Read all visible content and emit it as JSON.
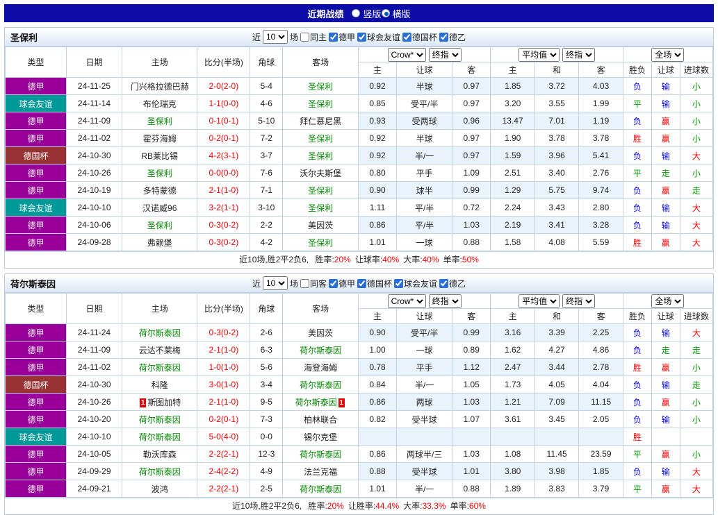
{
  "topbar": {
    "title": "近期战绩",
    "options": [
      {
        "label": "竖版",
        "selected": false
      },
      {
        "label": "横版",
        "selected": true
      }
    ]
  },
  "colors": {
    "type_bg": {
      "德甲": "#990099",
      "球会友谊": "#009999",
      "德国杯": "#993333"
    },
    "result_text": {
      "胜": "#ff0000",
      "平": "#009900",
      "负": "#0000ff",
      "赢": "#ff0000",
      "走": "#009900",
      "输": "#0000ff",
      "大": "#ff0000",
      "小": "#009900"
    },
    "focus_team": "#008800",
    "score": "#ff0000"
  },
  "table_header": {
    "static_cols": [
      "类型",
      "日期",
      "主场",
      "比分(半场)",
      "角球",
      "客场"
    ],
    "groups": [
      [
        "Crow*",
        "终指"
      ],
      [
        "平均值",
        "终指"
      ],
      [
        "全场"
      ]
    ],
    "sub_cols": [
      "主",
      "让球",
      "客",
      "主",
      "和",
      "客",
      "胜负",
      "让球",
      "进球数"
    ]
  },
  "sections": [
    {
      "team": "圣保利",
      "filter": {
        "recent_label": "近",
        "recent_value": "10",
        "games_label": "场",
        "same_label": "同主",
        "same_checked": false,
        "leagues": [
          {
            "label": "德甲",
            "checked": true
          },
          {
            "label": "球会友谊",
            "checked": true
          },
          {
            "label": "德国杯",
            "checked": true
          },
          {
            "label": "德乙",
            "checked": true
          }
        ]
      },
      "rows": [
        {
          "type": "德甲",
          "date": "24-11-25",
          "home": "门兴格拉德巴赫",
          "home_focus": false,
          "home_card": "",
          "score": "2-0(2-0)",
          "corner": "5-4",
          "away": "圣保利",
          "away_focus": true,
          "away_card": "",
          "odds": [
            "0.92",
            "半球",
            "0.97",
            "1.85",
            "3.72",
            "4.03"
          ],
          "results": [
            "负",
            "输",
            "小"
          ]
        },
        {
          "type": "球会友谊",
          "date": "24-11-14",
          "home": "布伦瑞克",
          "home_focus": false,
          "home_card": "",
          "score": "1-1(0-0)",
          "corner": "4-6",
          "away": "圣保利",
          "away_focus": true,
          "away_card": "",
          "odds": [
            "0.85",
            "受平/半",
            "0.97",
            "3.20",
            "3.55",
            "1.99"
          ],
          "results": [
            "平",
            "输",
            "小"
          ]
        },
        {
          "type": "德甲",
          "date": "24-11-09",
          "home": "圣保利",
          "home_focus": true,
          "home_card": "",
          "score": "0-1(0-1)",
          "corner": "5-10",
          "away": "拜仁慕尼黑",
          "away_focus": false,
          "away_card": "",
          "odds": [
            "0.93",
            "受两球",
            "0.96",
            "13.47",
            "7.01",
            "1.19"
          ],
          "results": [
            "负",
            "赢",
            "小"
          ]
        },
        {
          "type": "德甲",
          "date": "24-11-02",
          "home": "霍芬海姆",
          "home_focus": false,
          "home_card": "",
          "score": "0-2(0-1)",
          "corner": "7-2",
          "away": "圣保利",
          "away_focus": true,
          "away_card": "",
          "odds": [
            "0.92",
            "半球",
            "0.97",
            "1.90",
            "3.78",
            "3.78"
          ],
          "results": [
            "胜",
            "赢",
            "小"
          ]
        },
        {
          "type": "德国杯",
          "date": "24-10-30",
          "home": "RB莱比锡",
          "home_focus": false,
          "home_card": "",
          "score": "4-2(3-1)",
          "corner": "3-7",
          "away": "圣保利",
          "away_focus": true,
          "away_card": "",
          "odds": [
            "0.92",
            "半/一",
            "0.97",
            "1.59",
            "3.96",
            "5.41"
          ],
          "results": [
            "负",
            "输",
            "大"
          ]
        },
        {
          "type": "德甲",
          "date": "24-10-26",
          "home": "圣保利",
          "home_focus": true,
          "home_card": "",
          "score": "0-0(0-0)",
          "corner": "7-6",
          "away": "沃尔夫斯堡",
          "away_focus": false,
          "away_card": "",
          "odds": [
            "0.80",
            "平手",
            "1.09",
            "2.51",
            "3.40",
            "2.76"
          ],
          "results": [
            "平",
            "走",
            "小"
          ]
        },
        {
          "type": "德甲",
          "date": "24-10-19",
          "home": "多特蒙德",
          "home_focus": false,
          "home_card": "",
          "score": "2-1(1-0)",
          "corner": "7-1",
          "away": "圣保利",
          "away_focus": true,
          "away_card": "",
          "odds": [
            "0.90",
            "球半",
            "0.99",
            "1.29",
            "5.75",
            "9.74"
          ],
          "results": [
            "负",
            "赢",
            "走"
          ]
        },
        {
          "type": "球会友谊",
          "date": "24-10-10",
          "home": "汉诺威96",
          "home_focus": false,
          "home_card": "",
          "score": "3-2(1-1)",
          "corner": "3-10",
          "away": "圣保利",
          "away_focus": true,
          "away_card": "",
          "odds": [
            "1.11",
            "平/半",
            "0.72",
            "2.24",
            "3.43",
            "2.80"
          ],
          "results": [
            "负",
            "输",
            "大"
          ]
        },
        {
          "type": "德甲",
          "date": "24-10-06",
          "home": "圣保利",
          "home_focus": true,
          "home_card": "",
          "score": "0-3(0-2)",
          "corner": "2-2",
          "away": "美因茨",
          "away_focus": false,
          "away_card": "",
          "odds": [
            "0.86",
            "平/半",
            "1.03",
            "2.19",
            "3.41",
            "3.28"
          ],
          "results": [
            "负",
            "输",
            "大"
          ]
        },
        {
          "type": "德甲",
          "date": "24-09-28",
          "home": "弗赖堡",
          "home_focus": false,
          "home_card": "",
          "score": "0-3(0-2)",
          "corner": "4-2",
          "away": "圣保利",
          "away_focus": true,
          "away_card": "",
          "odds": [
            "1.01",
            "一球",
            "0.88",
            "1.58",
            "4.08",
            "5.59"
          ],
          "results": [
            "胜",
            "赢",
            "大"
          ]
        }
      ],
      "summary": {
        "prefix": "近10场,胜2平2负6, ",
        "stats": [
          {
            "label": "胜率:",
            "value": "20%"
          },
          {
            "label": "让球率:",
            "value": "40%"
          },
          {
            "label": "大率:",
            "value": "40%"
          },
          {
            "label": "单率:",
            "value": "50%"
          }
        ]
      }
    },
    {
      "team": "荷尔斯泰因",
      "filter": {
        "recent_label": "近",
        "recent_value": "10",
        "games_label": "场",
        "same_label": "同客",
        "same_checked": false,
        "leagues": [
          {
            "label": "德甲",
            "checked": true
          },
          {
            "label": "德国杯",
            "checked": true
          },
          {
            "label": "球会友谊",
            "checked": true
          },
          {
            "label": "德乙",
            "checked": true
          }
        ]
      },
      "rows": [
        {
          "type": "德甲",
          "date": "24-11-24",
          "home": "荷尔斯泰因",
          "home_focus": true,
          "home_card": "",
          "score": "0-3(0-2)",
          "corner": "2-6",
          "away": "美因茨",
          "away_focus": false,
          "away_card": "",
          "odds": [
            "0.90",
            "受平/半",
            "0.99",
            "3.16",
            "3.39",
            "2.25"
          ],
          "results": [
            "负",
            "输",
            "大"
          ]
        },
        {
          "type": "德甲",
          "date": "24-11-09",
          "home": "云达不莱梅",
          "home_focus": false,
          "home_card": "",
          "score": "2-1(1-0)",
          "corner": "6-3",
          "away": "荷尔斯泰因",
          "away_focus": true,
          "away_card": "",
          "odds": [
            "1.00",
            "一球",
            "0.89",
            "1.62",
            "4.27",
            "4.86"
          ],
          "results": [
            "负",
            "走",
            "走"
          ]
        },
        {
          "type": "德甲",
          "date": "24-11-02",
          "home": "荷尔斯泰因",
          "home_focus": true,
          "home_card": "",
          "score": "1-0(1-0)",
          "corner": "5-6",
          "away": "海登海姆",
          "away_focus": false,
          "away_card": "",
          "odds": [
            "0.78",
            "平手",
            "1.12",
            "2.47",
            "3.44",
            "2.78"
          ],
          "results": [
            "胜",
            "赢",
            "小"
          ]
        },
        {
          "type": "德国杯",
          "date": "24-10-30",
          "home": "科隆",
          "home_focus": false,
          "home_card": "",
          "score": "3-0(1-0)",
          "corner": "3-4",
          "away": "荷尔斯泰因",
          "away_focus": true,
          "away_card": "",
          "odds": [
            "0.84",
            "半/一",
            "1.05",
            "1.73",
            "4.05",
            "4.04"
          ],
          "results": [
            "负",
            "输",
            "走"
          ]
        },
        {
          "type": "德甲",
          "date": "24-10-26",
          "home": "斯图加特",
          "home_focus": false,
          "home_card": "1",
          "score": "2-1(1-0)",
          "corner": "9-5",
          "away": "荷尔斯泰因",
          "away_focus": true,
          "away_card": "1",
          "odds": [
            "0.86",
            "两球",
            "1.03",
            "1.21",
            "7.09",
            "11.15"
          ],
          "results": [
            "负",
            "赢",
            "小"
          ]
        },
        {
          "type": "德甲",
          "date": "24-10-20",
          "home": "荷尔斯泰因",
          "home_focus": true,
          "home_card": "",
          "score": "0-2(0-1)",
          "corner": "7-3",
          "away": "柏林联合",
          "away_focus": false,
          "away_card": "",
          "odds": [
            "0.82",
            "受半球",
            "1.07",
            "3.61",
            "3.45",
            "2.05"
          ],
          "results": [
            "负",
            "输",
            "小"
          ]
        },
        {
          "type": "球会友谊",
          "date": "24-10-10",
          "home": "荷尔斯泰因",
          "home_focus": true,
          "home_card": "",
          "score": "5-0(4-0)",
          "corner": "0-0",
          "away": "锡尔克堡",
          "away_focus": false,
          "away_card": "",
          "odds": [
            "",
            "",
            "",
            "",
            "",
            ""
          ],
          "results": [
            "胜",
            "",
            ""
          ]
        },
        {
          "type": "德甲",
          "date": "24-10-05",
          "home": "勒沃库森",
          "home_focus": false,
          "home_card": "",
          "score": "2-2(2-1)",
          "corner": "12-3",
          "away": "荷尔斯泰因",
          "away_focus": true,
          "away_card": "",
          "odds": [
            "0.86",
            "两球半/三",
            "1.03",
            "1.08",
            "11.45",
            "23.59"
          ],
          "results": [
            "平",
            "赢",
            "小"
          ]
        },
        {
          "type": "德甲",
          "date": "24-09-29",
          "home": "荷尔斯泰因",
          "home_focus": true,
          "home_card": "",
          "score": "2-4(2-2)",
          "corner": "4-9",
          "away": "法兰克福",
          "away_focus": false,
          "away_card": "",
          "odds": [
            "0.88",
            "受半球",
            "1.01",
            "3.80",
            "3.98",
            "1.85"
          ],
          "results": [
            "负",
            "输",
            "大"
          ]
        },
        {
          "type": "德甲",
          "date": "24-09-21",
          "home": "波鸿",
          "home_focus": false,
          "home_card": "",
          "score": "2-2(2-1)",
          "corner": "2-5",
          "away": "荷尔斯泰因",
          "away_focus": true,
          "away_card": "",
          "odds": [
            "1.01",
            "半/一",
            "0.88",
            "1.89",
            "3.83",
            "3.79"
          ],
          "results": [
            "平",
            "赢",
            "大"
          ]
        }
      ],
      "summary": {
        "prefix": "近10场,胜2平2负6, ",
        "stats": [
          {
            "label": "胜率:",
            "value": "20%"
          },
          {
            "label": "让胜率:",
            "value": "44.4%"
          },
          {
            "label": "大率:",
            "value": "33.3%"
          },
          {
            "label": "单率:",
            "value": "60%"
          }
        ]
      }
    }
  ]
}
